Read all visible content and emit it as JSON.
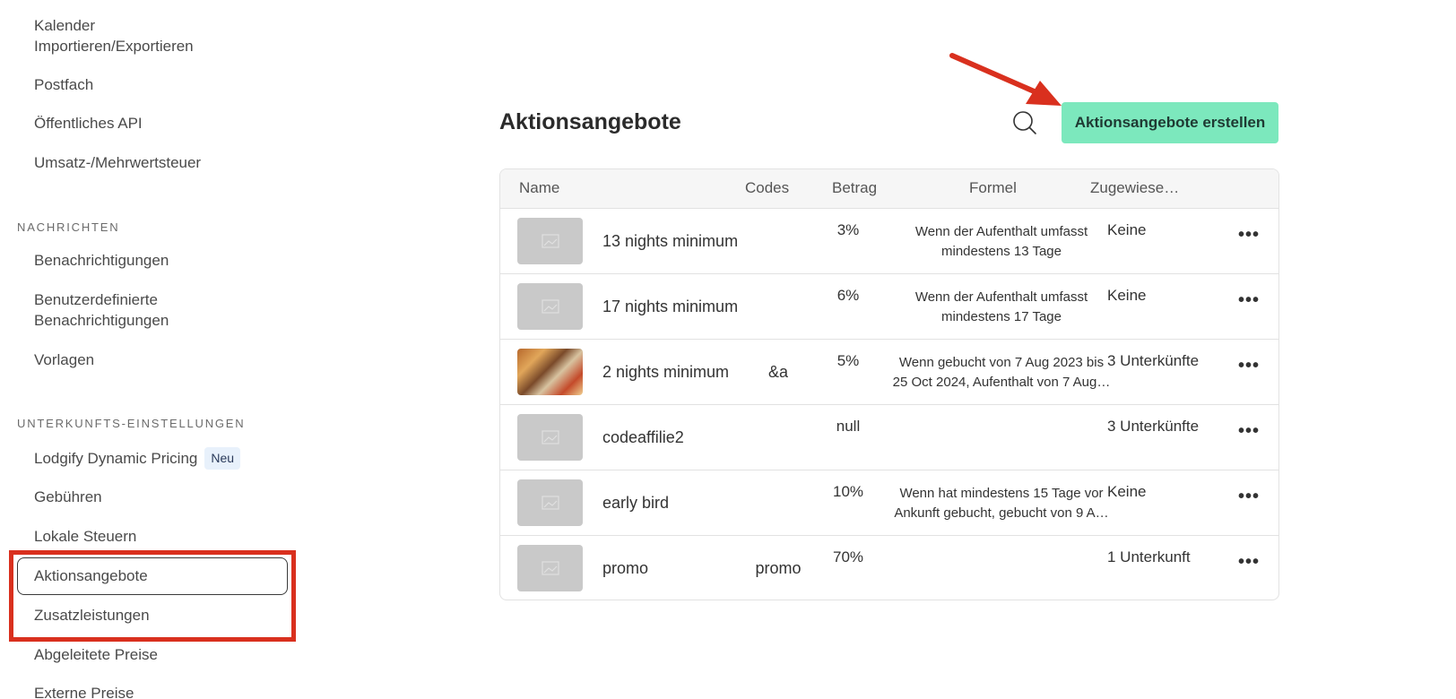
{
  "sidebar": {
    "top_items": [
      {
        "label": "Kalender"
      },
      {
        "label": "Importieren/Exportieren"
      },
      {
        "label": "Postfach"
      },
      {
        "label": "Öffentliches API"
      },
      {
        "label": "Umsatz-/Mehrwertsteuer"
      }
    ],
    "sections": [
      {
        "title": "NACHRICHTEN",
        "items": [
          {
            "label": "Benachrichtigungen"
          },
          {
            "label_line1": "Benutzerdefinierte",
            "label_line2": "Benachrichtigungen"
          },
          {
            "label": "Vorlagen"
          }
        ]
      },
      {
        "title": "UNTERKUNFTS-EINSTELLUNGEN",
        "items": [
          {
            "label": "Lodgify Dynamic Pricing",
            "badge": "Neu"
          },
          {
            "label": "Gebühren"
          },
          {
            "label": "Lokale Steuern"
          },
          {
            "label": "Aktionsangebote",
            "active": true
          },
          {
            "label": "Zusatzleistungen"
          },
          {
            "label": "Abgeleitete Preise"
          },
          {
            "label": "Externe Preise"
          }
        ]
      }
    ]
  },
  "main": {
    "title": "Aktionsangebote",
    "create_button": "Aktionsangebote erstellen",
    "search_icon": "search-icon",
    "columns": [
      "Name",
      "Codes",
      "Betrag",
      "Formel",
      "Zugewiese…"
    ],
    "rows": [
      {
        "name": "13 nights minimum",
        "code": "",
        "betrag": "3%",
        "formel_line1": "Wenn der Aufenthalt umfasst",
        "formel_line2": "mindestens 13 Tage",
        "assigned": "Keine",
        "thumb": "placeholder"
      },
      {
        "name": "17 nights minimum",
        "code": "",
        "betrag": "6%",
        "formel_line1": "Wenn der Aufenthalt umfasst",
        "formel_line2": "mindestens 17 Tage",
        "assigned": "Keine",
        "thumb": "placeholder"
      },
      {
        "name": "2 nights minimum",
        "code": "&a",
        "betrag": "5%",
        "formel_line1": "Wenn gebucht von 7 Aug 2023 bis",
        "formel_line2": "25 Oct 2024, Aufenthalt von 7 Aug…",
        "assigned": "3 Unterkünfte",
        "thumb": "photo"
      },
      {
        "name": "codeaffilie2",
        "code": "",
        "betrag": "null",
        "formel_line1": "",
        "formel_line2": "",
        "assigned": "3 Unterkünfte",
        "thumb": "placeholder"
      },
      {
        "name": "early bird",
        "code": "",
        "betrag": "10%",
        "formel_line1": "Wenn hat mindestens 15 Tage vor",
        "formel_line2": "Ankunft gebucht, gebucht von 9 A…",
        "assigned": "Keine",
        "thumb": "placeholder"
      },
      {
        "name": "promo",
        "code": "promo",
        "betrag": "70%",
        "formel_line1": "",
        "formel_line2": "",
        "assigned": "1 Unterkunft",
        "thumb": "placeholder"
      }
    ],
    "more_label": "•••"
  },
  "colors": {
    "accent_button": "#7ce8bd",
    "annotation_red": "#d9301e"
  }
}
